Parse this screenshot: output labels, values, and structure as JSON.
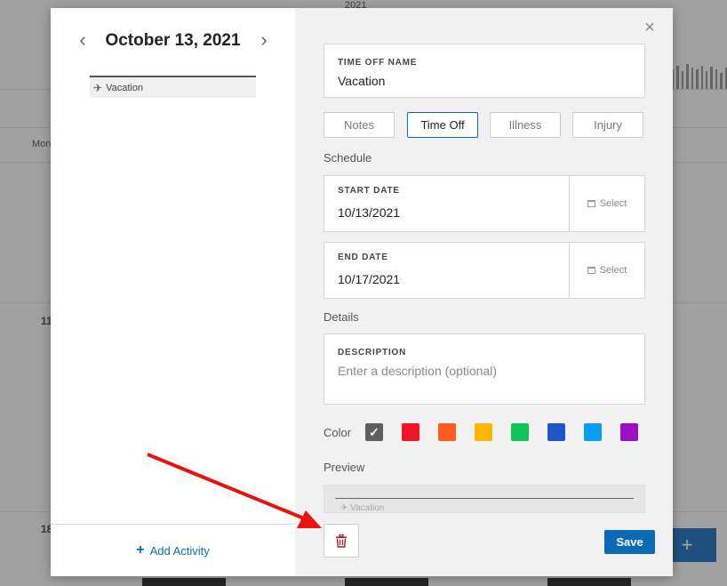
{
  "background": {
    "year_label": "2021",
    "weekday_label": "Mon",
    "row_label_1": "11",
    "row_label_2": "18",
    "add_button": "+"
  },
  "modal": {
    "date_title": "October 13, 2021",
    "activity_label": "Vacation",
    "add_activity_label": "Add Activity",
    "add_icon": "+",
    "close_icon": "×",
    "time_off_name": {
      "label": "TIME OFF NAME",
      "value": "Vacation"
    },
    "types": [
      {
        "label": "Notes"
      },
      {
        "label": "Time Off"
      },
      {
        "label": "Illness"
      },
      {
        "label": "Injury"
      }
    ],
    "schedule_heading": "Schedule",
    "start_date": {
      "label": "START DATE",
      "value": "10/13/2021",
      "select_label": "Select"
    },
    "end_date": {
      "label": "END DATE",
      "value": "10/17/2021",
      "select_label": "Select"
    },
    "details_heading": "Details",
    "description": {
      "label": "DESCRIPTION",
      "placeholder": "Enter a description (optional)"
    },
    "color_label": "Color",
    "colors": [
      "#5f5f5f",
      "#f0142a",
      "#ff5a1f",
      "#ffb400",
      "#0ec456",
      "#1e55c8",
      "#0a9cf2",
      "#9b10c4"
    ],
    "preview_heading": "Preview",
    "preview_label": "Vacation",
    "save_label": "Save"
  },
  "annotation": {
    "arrow_color": "#e8130e"
  }
}
